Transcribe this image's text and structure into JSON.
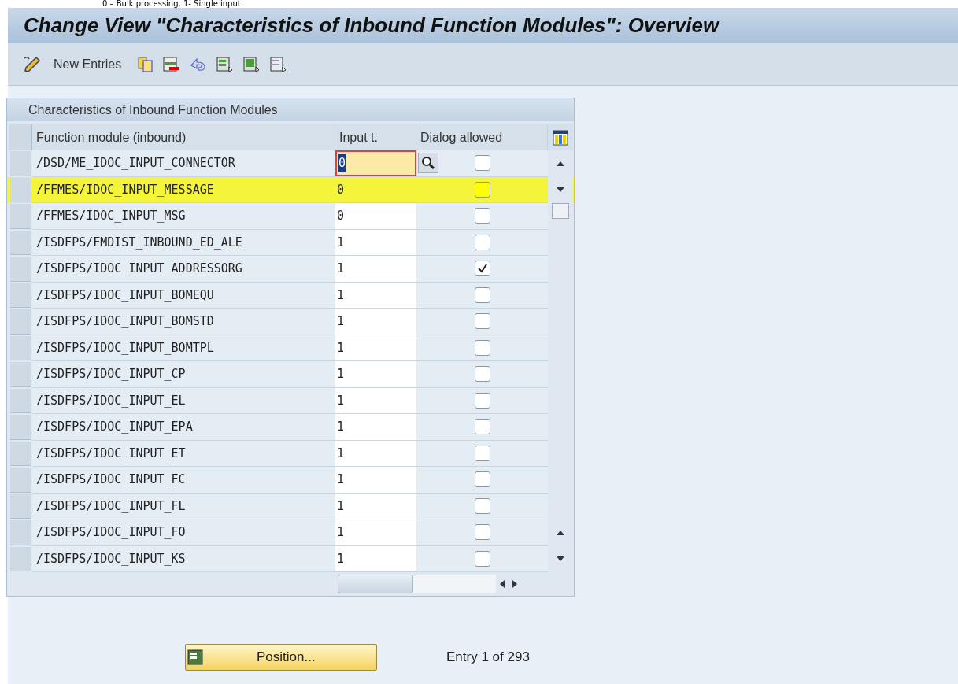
{
  "caption": "0 – Bulk processing, 1- Single input.",
  "window": {
    "title": "Change View \"Characteristics of Inbound Function Modules\": Overview"
  },
  "toolbar": {
    "new_entries": "New Entries"
  },
  "table": {
    "title": "Characteristics of Inbound Function Modules",
    "columns": [
      "Function module (inbound)",
      "Input t.",
      "Dialog allowed"
    ],
    "rows": [
      {
        "module": "/DSD/ME_IDOC_INPUT_CONNECTOR",
        "input_type": "0",
        "dialog_allowed": false,
        "focused": true,
        "highlighted": false
      },
      {
        "module": "/FFMES/IDOC_INPUT_MESSAGE",
        "input_type": "0",
        "dialog_allowed": false,
        "focused": false,
        "highlighted": true
      },
      {
        "module": "/FFMES/IDOC_INPUT_MSG",
        "input_type": "0",
        "dialog_allowed": false,
        "focused": false,
        "highlighted": false
      },
      {
        "module": "/ISDFPS/FMDIST_INBOUND_ED_ALE",
        "input_type": "1",
        "dialog_allowed": false,
        "focused": false,
        "highlighted": false
      },
      {
        "module": "/ISDFPS/IDOC_INPUT_ADDRESSORG",
        "input_type": "1",
        "dialog_allowed": true,
        "focused": false,
        "highlighted": false
      },
      {
        "module": "/ISDFPS/IDOC_INPUT_BOMEQU",
        "input_type": "1",
        "dialog_allowed": false,
        "focused": false,
        "highlighted": false
      },
      {
        "module": "/ISDFPS/IDOC_INPUT_BOMSTD",
        "input_type": "1",
        "dialog_allowed": false,
        "focused": false,
        "highlighted": false
      },
      {
        "module": "/ISDFPS/IDOC_INPUT_BOMTPL",
        "input_type": "1",
        "dialog_allowed": false,
        "focused": false,
        "highlighted": false
      },
      {
        "module": "/ISDFPS/IDOC_INPUT_CP",
        "input_type": "1",
        "dialog_allowed": false,
        "focused": false,
        "highlighted": false
      },
      {
        "module": "/ISDFPS/IDOC_INPUT_EL",
        "input_type": "1",
        "dialog_allowed": false,
        "focused": false,
        "highlighted": false
      },
      {
        "module": "/ISDFPS/IDOC_INPUT_EPA",
        "input_type": "1",
        "dialog_allowed": false,
        "focused": false,
        "highlighted": false
      },
      {
        "module": "/ISDFPS/IDOC_INPUT_ET",
        "input_type": "1",
        "dialog_allowed": false,
        "focused": false,
        "highlighted": false
      },
      {
        "module": "/ISDFPS/IDOC_INPUT_FC",
        "input_type": "1",
        "dialog_allowed": false,
        "focused": false,
        "highlighted": false
      },
      {
        "module": "/ISDFPS/IDOC_INPUT_FL",
        "input_type": "1",
        "dialog_allowed": false,
        "focused": false,
        "highlighted": false
      },
      {
        "module": "/ISDFPS/IDOC_INPUT_FO",
        "input_type": "1",
        "dialog_allowed": false,
        "focused": false,
        "highlighted": false
      },
      {
        "module": "/ISDFPS/IDOC_INPUT_KS",
        "input_type": "1",
        "dialog_allowed": false,
        "focused": false,
        "highlighted": false
      }
    ]
  },
  "position_button": "Position...",
  "entry_info": "Entry 1 of 293"
}
